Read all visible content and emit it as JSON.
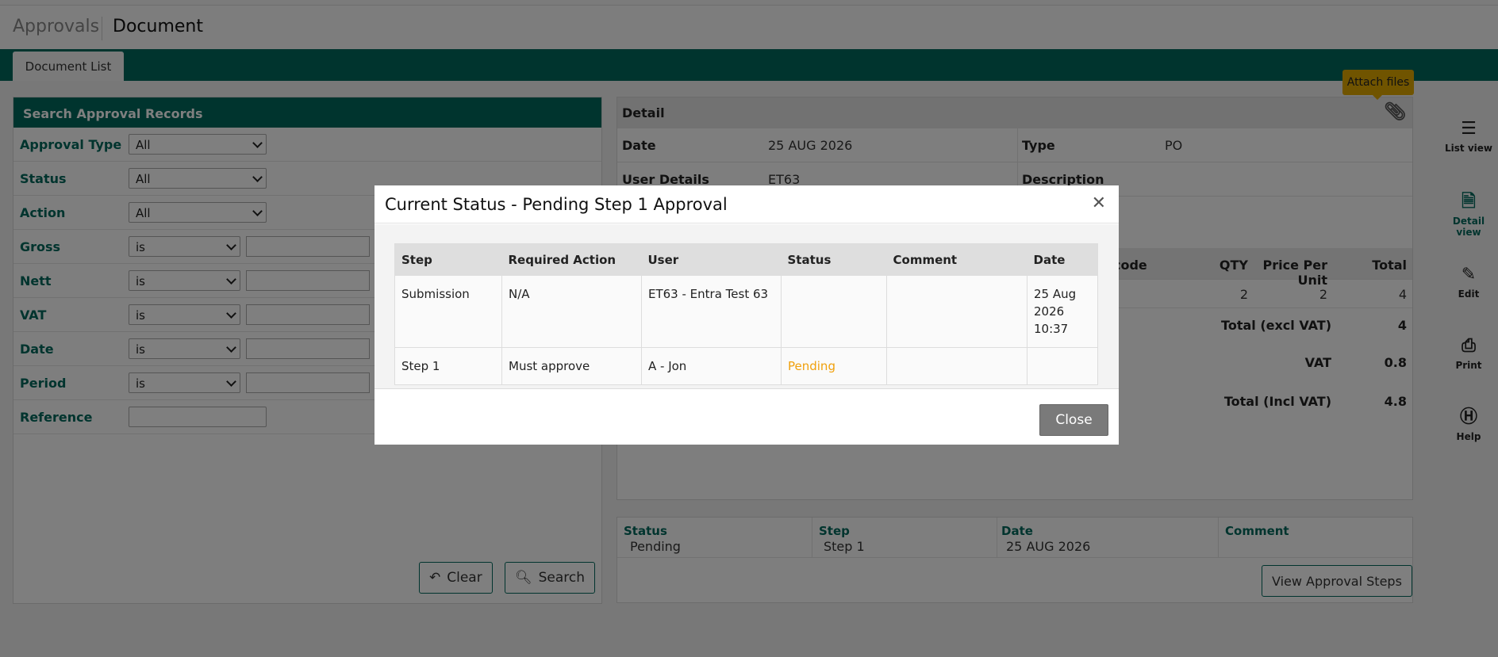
{
  "header": {
    "crumb_parent": "Approvals",
    "crumb_current": "Document"
  },
  "tabs": {
    "document_list": "Document List"
  },
  "search": {
    "title": "Search Approval Records",
    "fields": [
      {
        "label": "Approval Type",
        "value": "All"
      },
      {
        "label": "Status",
        "value": "All"
      },
      {
        "label": "Action",
        "value": "All"
      },
      {
        "label": "Gross",
        "value": "is"
      },
      {
        "label": "Nett",
        "value": "is"
      },
      {
        "label": "VAT",
        "value": "is"
      },
      {
        "label": "Date",
        "value": "is"
      },
      {
        "label": "Period",
        "value": "is"
      },
      {
        "label": "Reference",
        "value": ""
      }
    ],
    "clear_label": "Clear",
    "search_label": "Search"
  },
  "detail": {
    "title": "Detail",
    "date_label": "Date",
    "date_value": "25 AUG 2026",
    "type_label": "Type",
    "type_value": "PO",
    "user_label": "User Details",
    "user_value": "ET63",
    "description_label": "Description",
    "lines_header": {
      "code": "code",
      "qty": "QTY",
      "ppu": "Price Per Unit",
      "total": "Total"
    },
    "line": {
      "qty": "2",
      "ppu": "2",
      "total": "4"
    },
    "total_excl_label": "Total (excl VAT)",
    "total_excl_value": "4",
    "vat_label": "VAT",
    "vat_value": "0.8",
    "total_incl_label": "Total (Incl VAT)",
    "total_incl_value": "4.8"
  },
  "status_panel": {
    "status_label": "Status",
    "status_value": "Pending",
    "step_label": "Step",
    "step_value": "Step 1",
    "date_label": "Date",
    "date_value": "25 AUG 2026",
    "comment_label": "Comment",
    "view_steps_label": "View Approval Steps"
  },
  "attach_tooltip": "Attach files",
  "sidebar": {
    "list_view": "List view",
    "detail_view": "Detail view",
    "edit": "Edit",
    "print": "Print",
    "help": "Help"
  },
  "modal": {
    "title": "Current Status - Pending Step 1 Approval",
    "columns": [
      "Step",
      "Required Action",
      "User",
      "Status",
      "Comment",
      "Date"
    ],
    "rows": [
      {
        "step": "Submission",
        "action": "N/A",
        "user": "ET63 - Entra Test 63",
        "status": "",
        "comment": "",
        "date": "25 Aug 2026 10:37"
      },
      {
        "step": "Step 1",
        "action": "Must approve",
        "user": "A - Jon",
        "status": "Pending",
        "comment": "",
        "date": ""
      }
    ],
    "close_label": "Close"
  },
  "colors": {
    "brand": "#00695c",
    "pending": "#f0a00c",
    "tooltip": "#e0a800"
  }
}
